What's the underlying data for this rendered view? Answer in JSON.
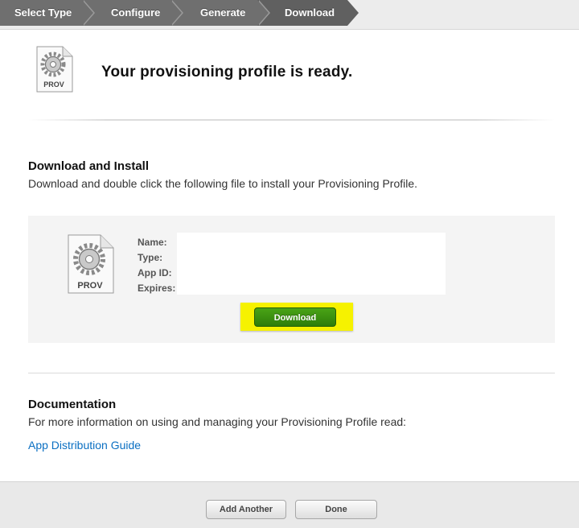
{
  "steps": [
    "Select Type",
    "Configure",
    "Generate",
    "Download"
  ],
  "header": {
    "title": "Your provisioning profile is ready.",
    "icon_label": "PROV"
  },
  "download_install": {
    "heading": "Download and Install",
    "text": "Download and double click the following file to install your Provisioning Profile.",
    "icon_label": "PROV",
    "fields": [
      "Name:",
      "Type:",
      "App ID:",
      "Expires:"
    ],
    "button": "Download"
  },
  "documentation": {
    "heading": "Documentation",
    "text": "For more information on using and managing your Provisioning Profile read:",
    "link": "App Distribution Guide"
  },
  "footer": {
    "add_another": "Add Another",
    "done": "Done"
  },
  "colors": {
    "highlight": "#f6f200",
    "download_button": "#3b8f10",
    "link": "#0a6fc2"
  }
}
